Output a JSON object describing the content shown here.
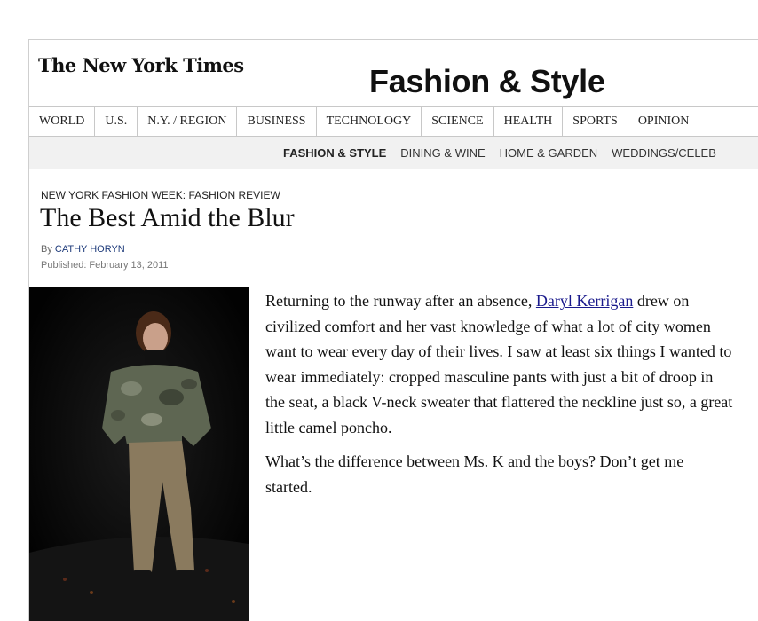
{
  "masthead": {
    "logo_text": "The New York Times"
  },
  "section_title": "Fashion & Style",
  "top_nav": [
    "WORLD",
    "U.S.",
    "N.Y. / REGION",
    "BUSINESS",
    "TECHNOLOGY",
    "SCIENCE",
    "HEALTH",
    "SPORTS",
    "OPINION"
  ],
  "sub_nav": [
    "FASHION & STYLE",
    "DINING & WINE",
    "HOME & GARDEN",
    "WEDDINGS/CELEB"
  ],
  "article": {
    "kicker": "NEW YORK FASHION WEEK: FASHION REVIEW",
    "headline": "The Best Amid the Blur",
    "byline_prefix": "By",
    "author": "CATHY HORYN",
    "published": "Published: February 13, 2011",
    "p1_before_link": "Returning to the runway after an absence, ",
    "p1_link": "Daryl Kerrigan",
    "p1_after_link": " drew on civilized comfort and her vast knowledge of what a lot of city women want to wear every day of their lives. I saw at least six things I wanted to wear immediately: cropped masculine pants with just a bit of droop in the seat, a black V-neck sweater that flattered the neckline just so, a great little camel poncho.",
    "p2": "What’s the difference between Ms. K and the boys? Don’t get me started."
  },
  "colors": {
    "link": "#1a1a8c",
    "byline_author": "#1d3a7a",
    "subnav_bg": "#f1f1f1",
    "photo_bg": "#050505"
  },
  "icons": {
    "photo": "runway-model-photo"
  }
}
